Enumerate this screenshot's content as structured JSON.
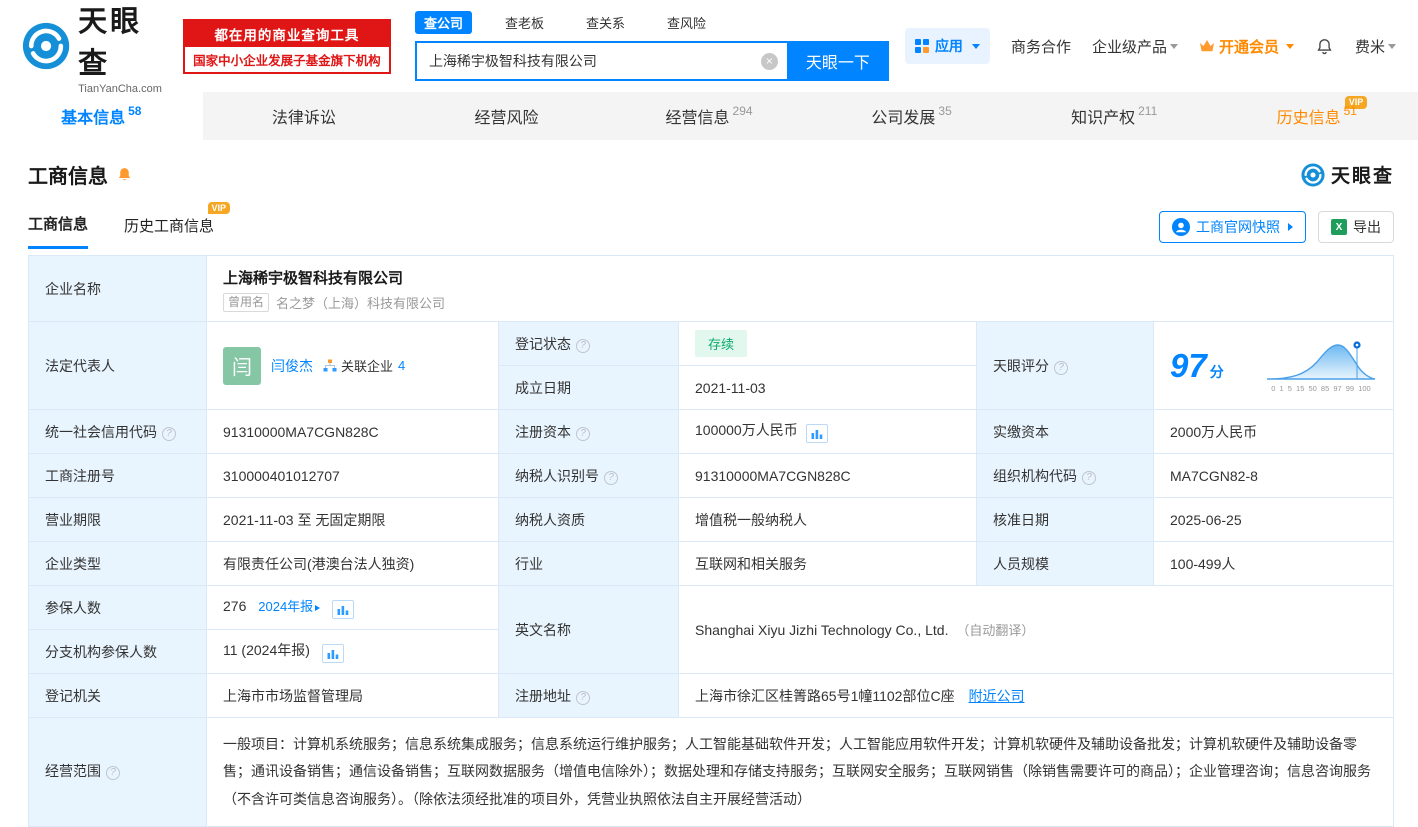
{
  "colors": {
    "primary_blue": "#0084ff",
    "orange": "#ff8a00",
    "red": "#e01616",
    "green": "#0bab6b"
  },
  "header": {
    "logo_text": "天眼查",
    "logo_domain": "TianYanCha.com",
    "promo_line1": "都在用的商业查询工具",
    "promo_line2": "国家中小企业发展子基金旗下机构",
    "search_tabs": [
      {
        "label": "查公司"
      },
      {
        "label": "查老板"
      },
      {
        "label": "查关系"
      },
      {
        "label": "查风险"
      }
    ],
    "search_value": "上海稀宇极智科技有限公司",
    "search_button": "天眼一下",
    "menu": {
      "apps": "应用",
      "cooperation": "商务合作",
      "enterprise": "企业级产品",
      "vip": "开通会员",
      "user": "费米"
    }
  },
  "nav": {
    "tabs": [
      {
        "label": "基本信息",
        "count": "58"
      },
      {
        "label": "法律诉讼",
        "count": ""
      },
      {
        "label": "经营风险",
        "count": ""
      },
      {
        "label": "经营信息",
        "count": "294"
      },
      {
        "label": "公司发展",
        "count": "35"
      },
      {
        "label": "知识产权",
        "count": "211"
      },
      {
        "label": "历史信息",
        "count": "51",
        "vip": "VIP"
      }
    ]
  },
  "section": {
    "title": "工商信息",
    "brand": "天眼查",
    "subtab_active": "工商信息",
    "subtab_history": "历史工商信息",
    "vip_badge": "VIP",
    "snapshot_button": "工商官网快照",
    "export_button": "导出"
  },
  "fields": {
    "company_name": {
      "label": "企业名称",
      "value": "上海稀宇极智科技有限公司"
    },
    "former_name": {
      "badge": "曾用名",
      "value": "名之梦（上海）科技有限公司"
    },
    "legal_rep": {
      "label": "法定代表人",
      "avatar": "闫",
      "name": "闫俊杰",
      "related_label": "关联企业",
      "related_count": "4"
    },
    "reg_status": {
      "label": "登记状态",
      "value": "存续"
    },
    "est_date": {
      "label": "成立日期",
      "value": "2021-11-03"
    },
    "score": {
      "label": "天眼评分",
      "value": "97",
      "unit": "分",
      "axis": "0 1 5 15 50 85 97 99 100"
    },
    "credit_code": {
      "label": "统一社会信用代码",
      "value": "91310000MA7CGN828C"
    },
    "reg_capital": {
      "label": "注册资本",
      "value": "100000万人民币"
    },
    "paid_capital": {
      "label": "实缴资本",
      "value": "2000万人民币"
    },
    "reg_no": {
      "label": "工商注册号",
      "value": "310000401012707"
    },
    "taxpayer_no": {
      "label": "纳税人识别号",
      "value": "91310000MA7CGN828C"
    },
    "org_code": {
      "label": "组织机构代码",
      "value": "MA7CGN82-8"
    },
    "biz_term": {
      "label": "营业期限",
      "value": "2021-11-03 至 无固定期限"
    },
    "taxpayer_quality": {
      "label": "纳税人资质",
      "value": "增值税一般纳税人"
    },
    "approve_date": {
      "label": "核准日期",
      "value": "2025-06-25"
    },
    "company_type": {
      "label": "企业类型",
      "value": "有限责任公司(港澳台法人独资)"
    },
    "industry": {
      "label": "行业",
      "value": "互联网和相关服务"
    },
    "staff_size": {
      "label": "人员规模",
      "value": "100-499人"
    },
    "insured": {
      "label": "参保人数",
      "value": "276",
      "report": "2024年报"
    },
    "english_name": {
      "label": "英文名称",
      "value": "Shanghai Xiyu Jizhi Technology Co., Ltd.",
      "note": "（自动翻译）"
    },
    "branch_insured": {
      "label": "分支机构参保人数",
      "value": "11 (2024年报)"
    },
    "reg_authority": {
      "label": "登记机关",
      "value": "上海市市场监督管理局"
    },
    "reg_address": {
      "label": "注册地址",
      "value": "上海市徐汇区桂箐路65号1幢1102部位C座",
      "nearby": "附近公司"
    },
    "business_scope": {
      "label": "经营范围",
      "value": "一般项目：计算机系统服务；信息系统集成服务；信息系统运行维护服务；人工智能基础软件开发；人工智能应用软件开发；计算机软硬件及辅助设备批发；计算机软硬件及辅助设备零售；通讯设备销售；通信设备销售；互联网数据服务（增值电信除外）；数据处理和存储支持服务；互联网安全服务；互联网销售（除销售需要许可的商品）；企业管理咨询；信息咨询服务（不含许可类信息咨询服务）。（除依法须经批准的项目外，凭营业执照依法自主开展经营活动）"
    }
  }
}
